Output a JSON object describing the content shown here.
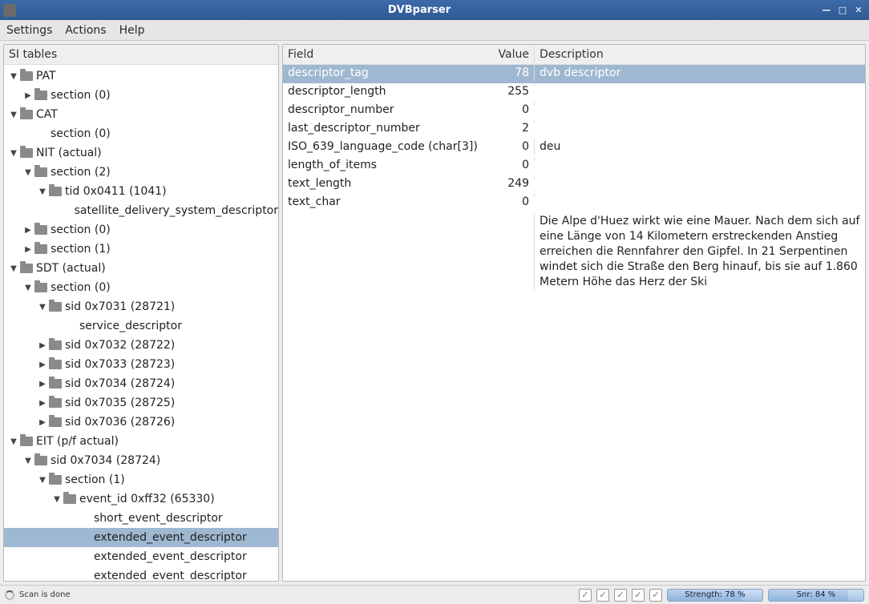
{
  "window": {
    "title": "DVBparser"
  },
  "menu": {
    "settings": "Settings",
    "actions": "Actions",
    "help": "Help"
  },
  "left_header": "SI tables",
  "right_headers": {
    "field": "Field",
    "value": "Value",
    "description": "Description"
  },
  "tree": [
    {
      "indent": 0,
      "arrow": "down",
      "folder": true,
      "label": "PAT"
    },
    {
      "indent": 1,
      "arrow": "right",
      "folder": true,
      "label": "section (0)"
    },
    {
      "indent": 0,
      "arrow": "down",
      "folder": true,
      "label": "CAT"
    },
    {
      "indent": 1,
      "arrow": "none",
      "folder": false,
      "label": "section (0)"
    },
    {
      "indent": 0,
      "arrow": "down",
      "folder": true,
      "label": "NIT (actual)"
    },
    {
      "indent": 1,
      "arrow": "down",
      "folder": true,
      "label": "section (2)"
    },
    {
      "indent": 2,
      "arrow": "down",
      "folder": true,
      "label": "tid 0x0411 (1041)"
    },
    {
      "indent": 3,
      "arrow": "none",
      "folder": false,
      "label": "satellite_delivery_system_descriptor"
    },
    {
      "indent": 1,
      "arrow": "right",
      "folder": true,
      "label": "section (0)"
    },
    {
      "indent": 1,
      "arrow": "right",
      "folder": true,
      "label": "section (1)"
    },
    {
      "indent": 0,
      "arrow": "down",
      "folder": true,
      "label": "SDT (actual)"
    },
    {
      "indent": 1,
      "arrow": "down",
      "folder": true,
      "label": "section (0)"
    },
    {
      "indent": 2,
      "arrow": "down",
      "folder": true,
      "label": "sid 0x7031 (28721)"
    },
    {
      "indent": 3,
      "arrow": "none",
      "folder": false,
      "label": "service_descriptor"
    },
    {
      "indent": 2,
      "arrow": "right",
      "folder": true,
      "label": "sid 0x7032 (28722)"
    },
    {
      "indent": 2,
      "arrow": "right",
      "folder": true,
      "label": "sid 0x7033 (28723)"
    },
    {
      "indent": 2,
      "arrow": "right",
      "folder": true,
      "label": "sid 0x7034 (28724)"
    },
    {
      "indent": 2,
      "arrow": "right",
      "folder": true,
      "label": "sid 0x7035 (28725)"
    },
    {
      "indent": 2,
      "arrow": "right",
      "folder": true,
      "label": "sid 0x7036 (28726)"
    },
    {
      "indent": 0,
      "arrow": "down",
      "folder": true,
      "label": "EIT (p/f actual)"
    },
    {
      "indent": 1,
      "arrow": "down",
      "folder": true,
      "label": "sid 0x7034 (28724)"
    },
    {
      "indent": 2,
      "arrow": "down",
      "folder": true,
      "label": "section (1)"
    },
    {
      "indent": 3,
      "arrow": "down",
      "folder": true,
      "label": "event_id 0xff32 (65330)"
    },
    {
      "indent": 4,
      "arrow": "none",
      "folder": false,
      "label": "short_event_descriptor"
    },
    {
      "indent": 4,
      "arrow": "none",
      "folder": false,
      "label": "extended_event_descriptor",
      "selected": true
    },
    {
      "indent": 4,
      "arrow": "none",
      "folder": false,
      "label": "extended_event_descriptor"
    },
    {
      "indent": 4,
      "arrow": "none",
      "folder": false,
      "label": "extended_event_descriptor"
    }
  ],
  "rows": [
    {
      "field": "descriptor_tag",
      "value": "78",
      "desc": "dvb descriptor",
      "selected": true
    },
    {
      "field": "descriptor_length",
      "value": "255",
      "desc": ""
    },
    {
      "field": "descriptor_number",
      "value": "0",
      "desc": ""
    },
    {
      "field": "last_descriptor_number",
      "value": "2",
      "desc": ""
    },
    {
      "field": "ISO_639_language_code (char[3])",
      "value": "0",
      "desc": "deu"
    },
    {
      "field": "length_of_items",
      "value": "0",
      "desc": ""
    },
    {
      "field": "text_length",
      "value": "249",
      "desc": ""
    },
    {
      "field": "text_char",
      "value": "0",
      "desc": ""
    }
  ],
  "long_desc": "Die Alpe d'Huez wirkt wie eine Mauer. Nach dem sich auf eine Länge von 14 Kilometern erstreckenden Anstieg erreichen die Rennfahrer den Gipfel. In 21 Serpentinen windet sich die Straße den Berg hinauf, bis sie auf 1.860 Metern Höhe das Herz der Ski",
  "status": {
    "scan": "Scan is done",
    "strength_label": "Strength: 78 %",
    "strength_pct": 78,
    "snr_label": "Snr: 84 %",
    "snr_pct": 84
  }
}
